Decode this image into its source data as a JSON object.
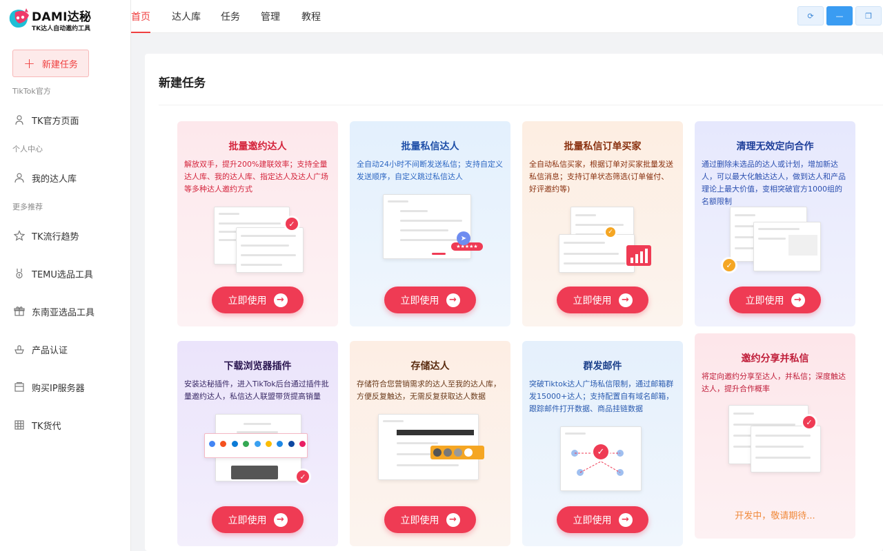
{
  "app": {
    "logo_title": "DAMI达秘",
    "logo_subtitle": "TK达人自动邀约工具"
  },
  "sidebar": {
    "new_task_label": "新建任务",
    "groups": [
      {
        "label": "TikTok官方"
      },
      {
        "label": "个人中心"
      },
      {
        "label": "更多推荐"
      }
    ],
    "items": [
      {
        "label": "TK官方页面",
        "icon": "user-outline-icon"
      },
      {
        "label": "我的达人库",
        "icon": "user-icon"
      },
      {
        "label": "TK流行趋势",
        "icon": "star-icon"
      },
      {
        "label": "TEMU选品工具",
        "icon": "medal-icon"
      },
      {
        "label": "东南亚选品工具",
        "icon": "gift-icon"
      },
      {
        "label": "产品认证",
        "icon": "badge-icon"
      },
      {
        "label": "购买IP服务器",
        "icon": "server-icon"
      },
      {
        "label": "TK货代",
        "icon": "building-icon"
      }
    ]
  },
  "topnav": {
    "tabs": [
      {
        "label": "首页",
        "active": true
      },
      {
        "label": "达人库",
        "active": false
      },
      {
        "label": "任务",
        "active": false
      },
      {
        "label": "管理",
        "active": false
      },
      {
        "label": "教程",
        "active": false
      }
    ],
    "window_controls": [
      "refresh-icon",
      "minimize-icon",
      "restore-icon"
    ]
  },
  "main": {
    "section_title": "新建任务",
    "cards": [
      {
        "title": "批量邀约达人",
        "desc": "解放双手，提升200%建联效率；支持全量达人库、我的达人库、指定达人及达人广场等多种达人邀约方式",
        "button": "立即使用"
      },
      {
        "title": "批量私信达人",
        "desc": "全自动24小时不间断发送私信；支持自定义发送顺序，自定义跳过私信达人",
        "button": "立即使用"
      },
      {
        "title": "批量私信订单买家",
        "desc": "全自动私信买家，根据订单对买家批量发送私信消息；支持订单状态筛选(订单催付、好评邀约等)",
        "button": "立即使用"
      },
      {
        "title": "清理无效定向合作",
        "desc": "通过删除未选品的达人或计划，增加新达人，可以最大化触达达人，做到达人和产品理论上最大价值，变相突破官方1000组的名额限制",
        "button": "立即使用"
      },
      {
        "title": "下载浏览器插件",
        "desc": "安装达秘插件，进入TikTok后台通过插件批量邀约达人，私信达人联盟带货提高销量",
        "button": "立即使用"
      },
      {
        "title": "存储达人",
        "desc": "存储符合您营销需求的达人至我的达人库，方便反复触达，无需反复获取达人数据",
        "button": "立即使用"
      },
      {
        "title": "群发邮件",
        "desc": "突破Tiktok达人广场私信限制，通过邮箱群发15000+达人；支持配置自有域名邮箱，跟踪邮件打开数据、商品挂链数据",
        "button": "立即使用"
      },
      {
        "title": "邀约分享并私信",
        "desc": "将定向邀约分享至达人，并私信；深度触达达人，提升合作概率",
        "status": "开发中，敬请期待..."
      }
    ]
  },
  "colors": {
    "accent": "#ef3e3e",
    "button": "#ef3b54",
    "primary_blue": "#3a9cf2"
  }
}
